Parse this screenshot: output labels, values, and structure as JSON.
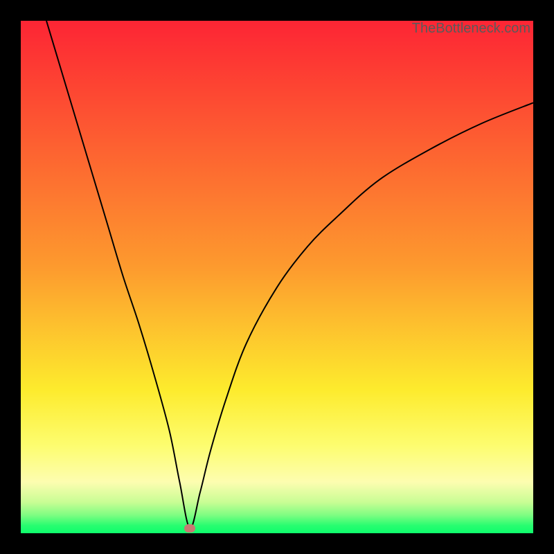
{
  "watermark": "TheBottleneck.com",
  "colors": {
    "top": "#fd2534",
    "mid_high": "#fd8f2f",
    "mid": "#fdeb2d",
    "mid_low": "#fdfd90",
    "pale": "#e6fdb0",
    "low": "#55fd77",
    "bottom": "#0efd6c",
    "curve": "#000000",
    "marker": "#c77a72",
    "frame": "#000000"
  },
  "chart_data": {
    "type": "line",
    "title": "",
    "xlabel": "",
    "ylabel": "",
    "x_range": [
      0,
      100
    ],
    "y_range": [
      0,
      100
    ],
    "minimum": {
      "x": 33,
      "y": 1
    },
    "series": [
      {
        "name": "bottleneck-curve",
        "x": [
          5,
          8,
          11,
          14,
          17,
          20,
          23,
          26,
          29,
          31,
          33,
          35,
          37,
          40,
          44,
          50,
          56,
          62,
          70,
          80,
          90,
          100
        ],
        "y": [
          100,
          90,
          80,
          70,
          60,
          50,
          41,
          31,
          20,
          10,
          1,
          8,
          16,
          26,
          37,
          48,
          56,
          62,
          69,
          75,
          80,
          84
        ]
      }
    ],
    "annotations": [
      {
        "type": "marker",
        "x": 33,
        "y": 1,
        "shape": "ellipse"
      }
    ],
    "background_gradient": {
      "stops": [
        {
          "pos": 0.0,
          "color": "#fd2534"
        },
        {
          "pos": 0.48,
          "color": "#fd9a2e"
        },
        {
          "pos": 0.72,
          "color": "#fdeb2d"
        },
        {
          "pos": 0.83,
          "color": "#fdfd70"
        },
        {
          "pos": 0.9,
          "color": "#fdfdb0"
        },
        {
          "pos": 0.94,
          "color": "#c8fd94"
        },
        {
          "pos": 0.965,
          "color": "#7dfd82"
        },
        {
          "pos": 0.985,
          "color": "#28fd70"
        },
        {
          "pos": 1.0,
          "color": "#0efd6c"
        }
      ]
    }
  }
}
